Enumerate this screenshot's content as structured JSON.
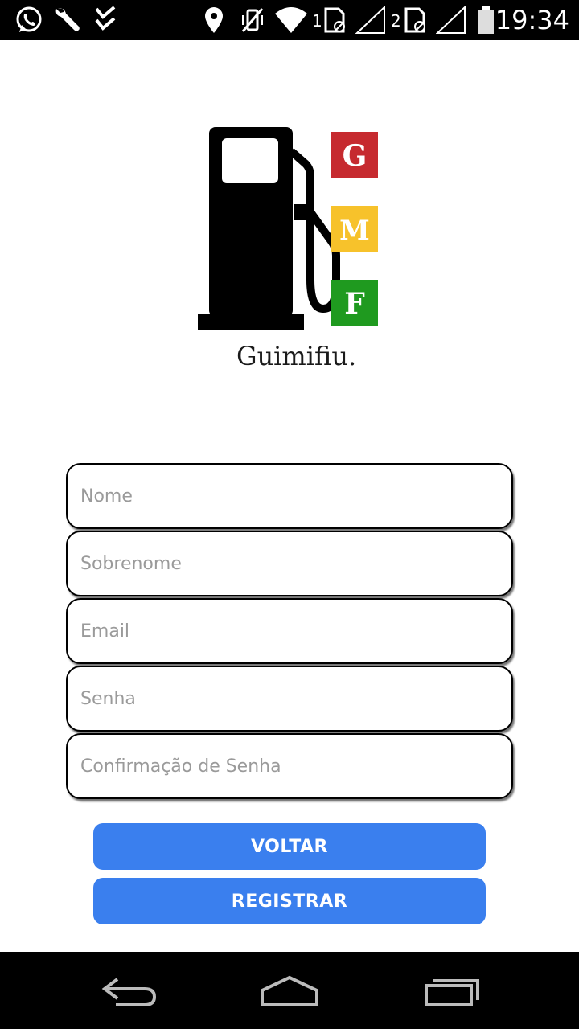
{
  "status_bar": {
    "time": "19:34",
    "sim1_label": "1",
    "sim2_label": "2",
    "left_icons": [
      "whatsapp-icon",
      "wrench-icon",
      "checklist-icon"
    ],
    "right_icons": [
      "location-icon",
      "vibrate-off-icon",
      "wifi-icon",
      "sim1-icon",
      "signal1-icon",
      "sim2-icon",
      "signal2-icon",
      "battery-icon"
    ]
  },
  "logo": {
    "name": "Guimifiu.",
    "letters": [
      {
        "char": "G",
        "color": "#c62a2f"
      },
      {
        "char": "M",
        "color": "#f7c22b"
      },
      {
        "char": "F",
        "color": "#1f9a1f"
      }
    ]
  },
  "form": {
    "nome_placeholder": "Nome",
    "sobrenome_placeholder": "Sobrenome",
    "email_placeholder": "Email",
    "senha_placeholder": "Senha",
    "confirm_placeholder": "Confirmação de Senha"
  },
  "buttons": {
    "voltar": "VOLTAR",
    "registrar": "REGISTRAR",
    "color": "#3a7fee"
  },
  "nav_bar": {
    "icons": [
      "back-icon",
      "home-icon",
      "recents-icon"
    ]
  }
}
